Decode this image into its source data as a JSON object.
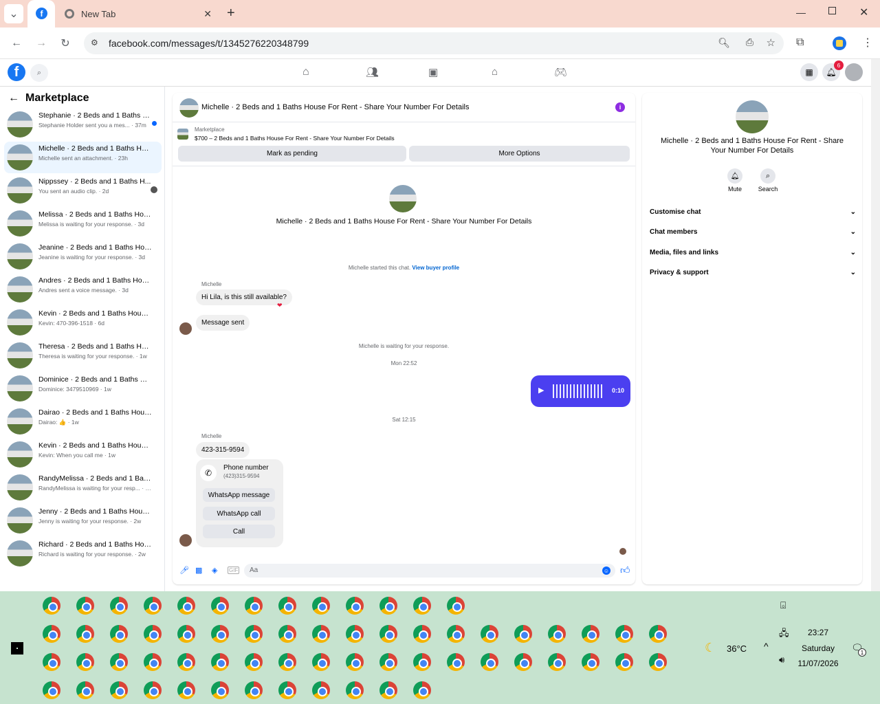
{
  "browser": {
    "tab_title": "New Tab",
    "url": "facebook.com/messages/t/1345276220348799",
    "notif_count": "6"
  },
  "sidebar": {
    "title": "Marketplace",
    "items": [
      {
        "title": "Stephanie · 2 Beds and 1 Baths H...",
        "sub": "Stephanie Holder sent you a mes... · 37m"
      },
      {
        "title": "Michelle · 2 Beds and 1 Baths Hous...",
        "sub": "Michelle sent an attachment. · 23h"
      },
      {
        "title": "Nippssey · 2 Beds and 1 Baths H...",
        "sub": "You sent an audio clip. · 2d"
      },
      {
        "title": "Melissa · 2 Beds and 1 Baths Hous...",
        "sub": "Melissa is waiting for your response. · 3d"
      },
      {
        "title": "Jeanine · 2 Beds and 1 Baths Hous...",
        "sub": "Jeanine is waiting for your response. · 3d"
      },
      {
        "title": "Andres · 2 Beds and 1 Baths House...",
        "sub": "Andres sent a voice message. · 3d"
      },
      {
        "title": "Kevin · 2 Beds and 1 Baths House F...",
        "sub": "Kevin: 470-396-1518 · 6d"
      },
      {
        "title": "Theresa · 2 Beds and 1 Baths Hous...",
        "sub": "Theresa is waiting for your response. · 1w"
      },
      {
        "title": "Dominice · 2 Beds and 1 Baths Ho...",
        "sub": "Dominice: 3479510969 · 1w"
      },
      {
        "title": "Dairao · 2 Beds and 1 Baths House ...",
        "sub": "Dairao: 👍 · 1w"
      },
      {
        "title": "Kevin · 2 Beds and 1 Baths House F...",
        "sub": "Kevin: When you call me · 1w"
      },
      {
        "title": "RandyMelissa · 2 Beds and 1 Baths ...",
        "sub": "RandyMelissa is waiting for your resp... · 1w"
      },
      {
        "title": "Jenny · 2 Beds and 1 Baths House ...",
        "sub": "Jenny is waiting for your response. · 2w"
      },
      {
        "title": "Richard · 2 Beds and 1 Baths Hous...",
        "sub": "Richard is waiting for your response. · 2w"
      }
    ]
  },
  "chat": {
    "title": "Michelle · 2 Beds and 1 Baths House For Rent - Share Your Number For Details",
    "mp_label": "Marketplace",
    "listing": "$700 – 2 Beds and 1 Baths House For Rent - Share Your Number For Details",
    "mark_pending": "Mark as pending",
    "more_options": "More Options",
    "started": "Michelle started this chat.",
    "view_profile": "View buyer profile",
    "sender": "Michelle",
    "msg1": "Hi Lila, is this still available?",
    "msg2": "Message sent",
    "waiting": "Michelle is waiting for your response.",
    "time1": "Mon 22:52",
    "audio_len": "0:10",
    "time2": "Sat 12:15",
    "phone_msg": "423-315-9594",
    "phone_label": "Phone number",
    "phone_val": "(423)315-9594",
    "wa_msg": "WhatsApp message",
    "wa_call": "WhatsApp call",
    "call": "Call",
    "input_placeholder": "Aa"
  },
  "info": {
    "title": "Michelle · 2 Beds and 1 Baths House For Rent - Share Your Number For Details",
    "mute": "Mute",
    "search": "Search",
    "sections": [
      "Customise chat",
      "Chat members",
      "Media, files and links",
      "Privacy & support"
    ]
  },
  "taskbar": {
    "temp": "36°C",
    "time": "23:27",
    "day": "Saturday",
    "date": "11/07/2026",
    "notif": "1"
  }
}
